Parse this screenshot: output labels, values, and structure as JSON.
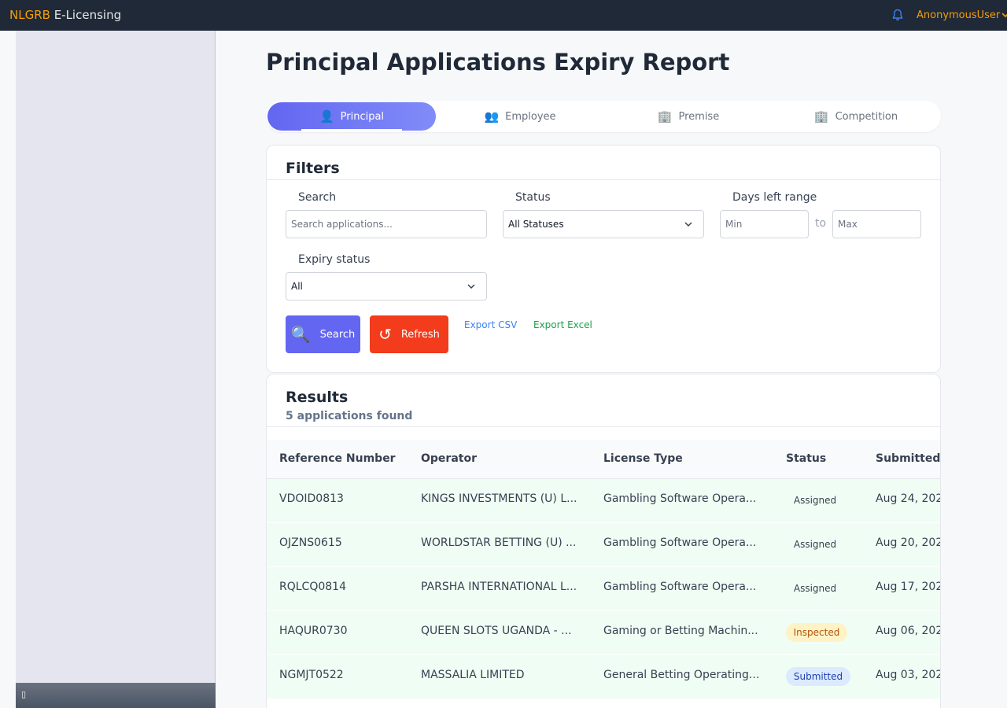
{
  "header": {
    "brand_accent": "NLGRB",
    "brand_rest": " E-Licensing",
    "user_name": "AnonymousUser"
  },
  "page": {
    "title": "Principal Applications Expiry Report"
  },
  "tabs": [
    {
      "label": "Principal",
      "icon": "👤",
      "active": true
    },
    {
      "label": "Employee",
      "icon": "👥",
      "active": false
    },
    {
      "label": "Premise",
      "icon": "🏢",
      "active": false
    },
    {
      "label": "Competition",
      "icon": "🏢",
      "active": false
    }
  ],
  "filters": {
    "title": "Filters",
    "search_label": "Search",
    "search_placeholder": "Search applications...",
    "status_label": "Status",
    "status_value": "All Statuses",
    "days_label": "Days left range",
    "min_placeholder": "Min",
    "to_label": "to",
    "max_placeholder": "Max",
    "expiry_label": "Expiry status",
    "expiry_value": "All",
    "search_button": "Search",
    "refresh_button": "Refresh",
    "export_csv": "Export CSV",
    "export_excel": "Export Excel"
  },
  "results": {
    "title": "Results",
    "count_text": "5 applications found",
    "columns": [
      "Reference Number",
      "Operator",
      "License Type",
      "Status",
      "Submitted"
    ],
    "rows": [
      {
        "ref": "VDOID0813",
        "operator": "KINGS INVESTMENTS (U) L...",
        "license": "Gambling Software Opera...",
        "status": "Assigned",
        "status_kind": "assigned",
        "submitted": "Aug 24, 202"
      },
      {
        "ref": "OJZNS0615",
        "operator": "WORLDSTAR BETTING (U) ...",
        "license": "Gambling Software Opera...",
        "status": "Assigned",
        "status_kind": "assigned",
        "submitted": "Aug 20, 202"
      },
      {
        "ref": "RQLCQ0814",
        "operator": "PARSHA INTERNATIONAL L...",
        "license": "Gambling Software Opera...",
        "status": "Assigned",
        "status_kind": "assigned",
        "submitted": "Aug 17, 202"
      },
      {
        "ref": "HAQUR0730",
        "operator": "QUEEN SLOTS UGANDA - ...",
        "license": "Gaming or Betting Machin...",
        "status": "Inspected",
        "status_kind": "inspected",
        "submitted": "Aug 06, 202"
      },
      {
        "ref": "NGMJT0522",
        "operator": "MASSALIA LIMITED",
        "license": "General Betting Operating...",
        "status": "Submitted",
        "status_kind": "submitted",
        "submitted": "Aug 03, 202"
      }
    ]
  },
  "colors": {
    "accent": "#6366f1",
    "brand": "#f59e0b",
    "refresh": "#f23c1c",
    "row_bg": "#f0fdf4"
  },
  "icons": {
    "bell": "bell-icon",
    "search": "magnifier-icon",
    "refresh": "refresh-icon",
    "sidebar_toggle": "sidebar-toggle-icon"
  }
}
